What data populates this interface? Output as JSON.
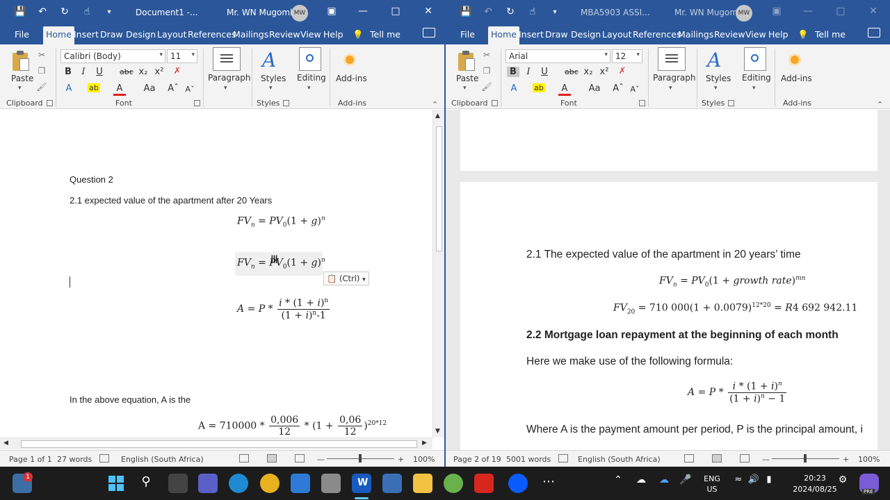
{
  "left_window": {
    "doc_title": "Document1  -...",
    "user_name": "Mr. WN Mugombi",
    "avatar_initials": "MW",
    "tabs": [
      "File",
      "Home",
      "Insert",
      "Draw",
      "Design",
      "Layout",
      "References",
      "Mailings",
      "Review",
      "View",
      "Help"
    ],
    "tell_me": "Tell me",
    "ribbon": {
      "paste_label": "Paste",
      "font_name": "Calibri (Body)",
      "font_size": "11",
      "paragraph_label": "Paragraph",
      "styles_label": "Styles",
      "editing_label": "Editing",
      "addins_label": "Add-ins",
      "group_clipboard": "Clipboard",
      "group_font": "Font",
      "group_styles": "Styles",
      "group_addins": "Add-ins"
    },
    "doc": {
      "heading": "Question 2",
      "line1": "2.1 expected value of the apartment after 20 Years",
      "paste_options": "(Ctrl)",
      "line2": "In the above equation, A is the"
    },
    "status": {
      "page": "Page 1 of 1",
      "words": "27 words",
      "language": "English (South Africa)",
      "zoom": "100%"
    }
  },
  "right_window": {
    "doc_title": "MBA5903 ASSI...",
    "user_name": "Mr. WN Mugombi",
    "avatar_initials": "MW",
    "tabs": [
      "File",
      "Home",
      "Insert",
      "Draw",
      "Design",
      "Layout",
      "References",
      "Mailings",
      "Review",
      "View",
      "Help"
    ],
    "tell_me": "Tell me",
    "ribbon": {
      "paste_label": "Paste",
      "font_name": "Arial",
      "font_size": "12",
      "paragraph_label": "Paragraph",
      "styles_label": "Styles",
      "editing_label": "Editing",
      "addins_label": "Add-ins",
      "group_clipboard": "Clipboard",
      "group_font": "Font",
      "group_styles": "Styles",
      "group_addins": "Add-ins"
    },
    "doc": {
      "line1": "2.1 The expected value of the apartment in 20 years’ time",
      "heading2": "2.2 Mortgage loan repayment at the beginning of each month",
      "line2": "Here we make use of the following formula:",
      "line3": "Where A is the payment amount per period, P is the principal amount, i"
    },
    "status": {
      "page": "Page 2 of 19",
      "words": "5001 words",
      "language": "English (South Africa)",
      "zoom": "100%"
    }
  },
  "taskbar": {
    "weather_badge": "1",
    "teams_badge": "",
    "lang_top": "ENG",
    "lang_bottom": "US",
    "time": "20:23",
    "date": "2024/08/25",
    "copilot_badge": "PRE"
  },
  "colors": {
    "word_blue": "#2b579a",
    "ribbon_bg": "#f3f3f3",
    "taskbar_bg": "#1c1c1c"
  }
}
